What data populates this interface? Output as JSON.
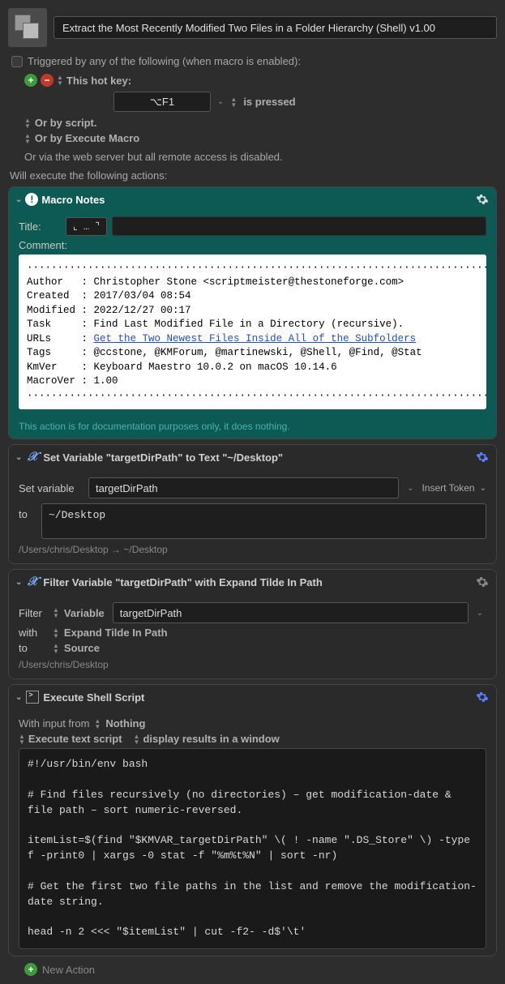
{
  "macro": {
    "title": "Extract the Most Recently Modified Two Files in a Folder Hierarchy (Shell) v1.00",
    "trigger_header": "Triggered by any of the following (when macro is enabled):",
    "hotkey_label": "This hot key:",
    "hotkey_value": "⌥F1",
    "hotkey_state": "is pressed",
    "or_script": "Or by script.",
    "or_execute_macro": "Or by Execute Macro",
    "or_web": "Or via the web server but all remote access is disabled.",
    "exec_header": "Will execute the following actions:"
  },
  "notes": {
    "header": "Macro Notes",
    "title_label": "Title:",
    "title_field": "⌞ … ⌝",
    "comment_label": "Comment:",
    "dots": "······················································································································",
    "author_k": "Author",
    "author_v": "Christopher Stone <scriptmeister@thestoneforge.com>",
    "created_k": "Created",
    "created_v": "2017/03/04 08:54",
    "modified_k": "Modified",
    "modified_v": "2022/12/27 00:17",
    "task_k": "Task",
    "task_v": "Find Last Modified File in a Directory (recursive).",
    "urls_k": "URLs",
    "urls_v": "Get the Two Newest Files Inside All of the Subfolders",
    "tags_k": "Tags",
    "tags_v": "@ccstone, @KMForum, @martinewski, @Shell, @Find, @Stat",
    "kmver_k": "KmVer",
    "kmver_v": "Keyboard Maestro 10.0.2 on macOS 10.14.6",
    "macrover_k": "MacroVer",
    "macrover_v": "1.00",
    "footnote": "This action is for documentation purposes only, it does nothing."
  },
  "setvar": {
    "header": "Set Variable \"targetDirPath\" to Text \"~/Desktop\"",
    "set_label": "Set variable",
    "var_name": "targetDirPath",
    "insert_token": "Insert Token",
    "to_label": "to",
    "to_value": "~/Desktop",
    "result": "/Users/chris/Desktop → ~/Desktop"
  },
  "filter": {
    "header": "Filter Variable \"targetDirPath\" with Expand Tilde In Path",
    "filter_label": "Filter",
    "variable_label": "Variable",
    "var_name": "targetDirPath",
    "with_label": "with",
    "with_value": "Expand Tilde In Path",
    "to_label": "to",
    "to_value": "Source",
    "result": "/Users/chris/Desktop"
  },
  "shell": {
    "header": "Execute Shell Script",
    "input_label": "With input from",
    "input_value": "Nothing",
    "script_mode": "Execute text script",
    "output_mode": "display results in a window",
    "code": "#!/usr/bin/env bash\n\n# Find files recursively (no directories) – get modification-date & file path – sort numeric-reversed.\n\nitemList=$(find \"$KMVAR_targetDirPath\" \\( ! -name \".DS_Store\" \\) -type f -print0 | xargs -0 stat -f \"%m%t%N\" | sort -nr)\n\n# Get the first two file paths in the list and remove the modification-date string.\n\nhead -n 2 <<< \"$itemList\" | cut -f2- -d$'\\t'"
  },
  "footer": {
    "new_action": "New Action"
  }
}
